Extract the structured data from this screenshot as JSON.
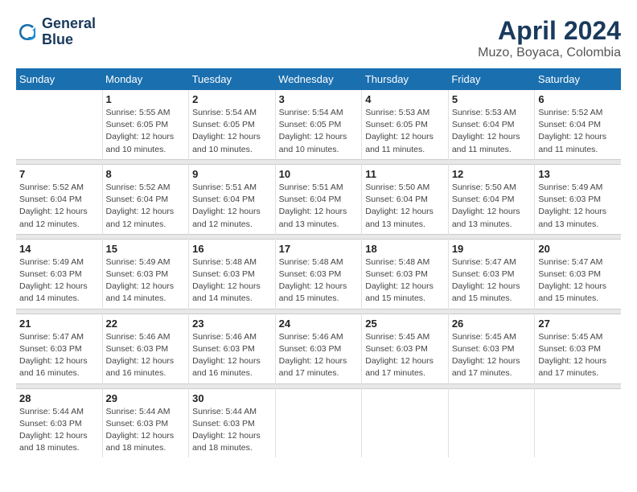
{
  "header": {
    "logo_line1": "General",
    "logo_line2": "Blue",
    "title": "April 2024",
    "subtitle": "Muzo, Boyaca, Colombia"
  },
  "columns": [
    "Sunday",
    "Monday",
    "Tuesday",
    "Wednesday",
    "Thursday",
    "Friday",
    "Saturday"
  ],
  "weeks": [
    {
      "days": [
        {
          "num": "",
          "info": ""
        },
        {
          "num": "1",
          "info": "Sunrise: 5:55 AM\nSunset: 6:05 PM\nDaylight: 12 hours\nand 10 minutes."
        },
        {
          "num": "2",
          "info": "Sunrise: 5:54 AM\nSunset: 6:05 PM\nDaylight: 12 hours\nand 10 minutes."
        },
        {
          "num": "3",
          "info": "Sunrise: 5:54 AM\nSunset: 6:05 PM\nDaylight: 12 hours\nand 10 minutes."
        },
        {
          "num": "4",
          "info": "Sunrise: 5:53 AM\nSunset: 6:05 PM\nDaylight: 12 hours\nand 11 minutes."
        },
        {
          "num": "5",
          "info": "Sunrise: 5:53 AM\nSunset: 6:04 PM\nDaylight: 12 hours\nand 11 minutes."
        },
        {
          "num": "6",
          "info": "Sunrise: 5:52 AM\nSunset: 6:04 PM\nDaylight: 12 hours\nand 11 minutes."
        }
      ]
    },
    {
      "days": [
        {
          "num": "7",
          "info": "Sunrise: 5:52 AM\nSunset: 6:04 PM\nDaylight: 12 hours\nand 12 minutes."
        },
        {
          "num": "8",
          "info": "Sunrise: 5:52 AM\nSunset: 6:04 PM\nDaylight: 12 hours\nand 12 minutes."
        },
        {
          "num": "9",
          "info": "Sunrise: 5:51 AM\nSunset: 6:04 PM\nDaylight: 12 hours\nand 12 minutes."
        },
        {
          "num": "10",
          "info": "Sunrise: 5:51 AM\nSunset: 6:04 PM\nDaylight: 12 hours\nand 13 minutes."
        },
        {
          "num": "11",
          "info": "Sunrise: 5:50 AM\nSunset: 6:04 PM\nDaylight: 12 hours\nand 13 minutes."
        },
        {
          "num": "12",
          "info": "Sunrise: 5:50 AM\nSunset: 6:04 PM\nDaylight: 12 hours\nand 13 minutes."
        },
        {
          "num": "13",
          "info": "Sunrise: 5:49 AM\nSunset: 6:03 PM\nDaylight: 12 hours\nand 13 minutes."
        }
      ]
    },
    {
      "days": [
        {
          "num": "14",
          "info": "Sunrise: 5:49 AM\nSunset: 6:03 PM\nDaylight: 12 hours\nand 14 minutes."
        },
        {
          "num": "15",
          "info": "Sunrise: 5:49 AM\nSunset: 6:03 PM\nDaylight: 12 hours\nand 14 minutes."
        },
        {
          "num": "16",
          "info": "Sunrise: 5:48 AM\nSunset: 6:03 PM\nDaylight: 12 hours\nand 14 minutes."
        },
        {
          "num": "17",
          "info": "Sunrise: 5:48 AM\nSunset: 6:03 PM\nDaylight: 12 hours\nand 15 minutes."
        },
        {
          "num": "18",
          "info": "Sunrise: 5:48 AM\nSunset: 6:03 PM\nDaylight: 12 hours\nand 15 minutes."
        },
        {
          "num": "19",
          "info": "Sunrise: 5:47 AM\nSunset: 6:03 PM\nDaylight: 12 hours\nand 15 minutes."
        },
        {
          "num": "20",
          "info": "Sunrise: 5:47 AM\nSunset: 6:03 PM\nDaylight: 12 hours\nand 15 minutes."
        }
      ]
    },
    {
      "days": [
        {
          "num": "21",
          "info": "Sunrise: 5:47 AM\nSunset: 6:03 PM\nDaylight: 12 hours\nand 16 minutes."
        },
        {
          "num": "22",
          "info": "Sunrise: 5:46 AM\nSunset: 6:03 PM\nDaylight: 12 hours\nand 16 minutes."
        },
        {
          "num": "23",
          "info": "Sunrise: 5:46 AM\nSunset: 6:03 PM\nDaylight: 12 hours\nand 16 minutes."
        },
        {
          "num": "24",
          "info": "Sunrise: 5:46 AM\nSunset: 6:03 PM\nDaylight: 12 hours\nand 17 minutes."
        },
        {
          "num": "25",
          "info": "Sunrise: 5:45 AM\nSunset: 6:03 PM\nDaylight: 12 hours\nand 17 minutes."
        },
        {
          "num": "26",
          "info": "Sunrise: 5:45 AM\nSunset: 6:03 PM\nDaylight: 12 hours\nand 17 minutes."
        },
        {
          "num": "27",
          "info": "Sunrise: 5:45 AM\nSunset: 6:03 PM\nDaylight: 12 hours\nand 17 minutes."
        }
      ]
    },
    {
      "days": [
        {
          "num": "28",
          "info": "Sunrise: 5:44 AM\nSunset: 6:03 PM\nDaylight: 12 hours\nand 18 minutes."
        },
        {
          "num": "29",
          "info": "Sunrise: 5:44 AM\nSunset: 6:03 PM\nDaylight: 12 hours\nand 18 minutes."
        },
        {
          "num": "30",
          "info": "Sunrise: 5:44 AM\nSunset: 6:03 PM\nDaylight: 12 hours\nand 18 minutes."
        },
        {
          "num": "",
          "info": ""
        },
        {
          "num": "",
          "info": ""
        },
        {
          "num": "",
          "info": ""
        },
        {
          "num": "",
          "info": ""
        }
      ]
    }
  ]
}
